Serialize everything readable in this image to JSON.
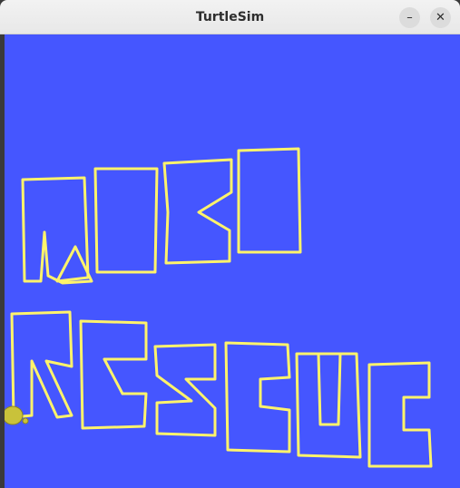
{
  "window": {
    "title": "TurtleSim",
    "minimize_glyph": "–",
    "close_glyph": "✕"
  },
  "canvas": {
    "background_color": "#4556ff",
    "pen_color": "#fff36b"
  },
  "turtle": {
    "icon": "turtle-icon",
    "body_color": "#c9c23a"
  }
}
